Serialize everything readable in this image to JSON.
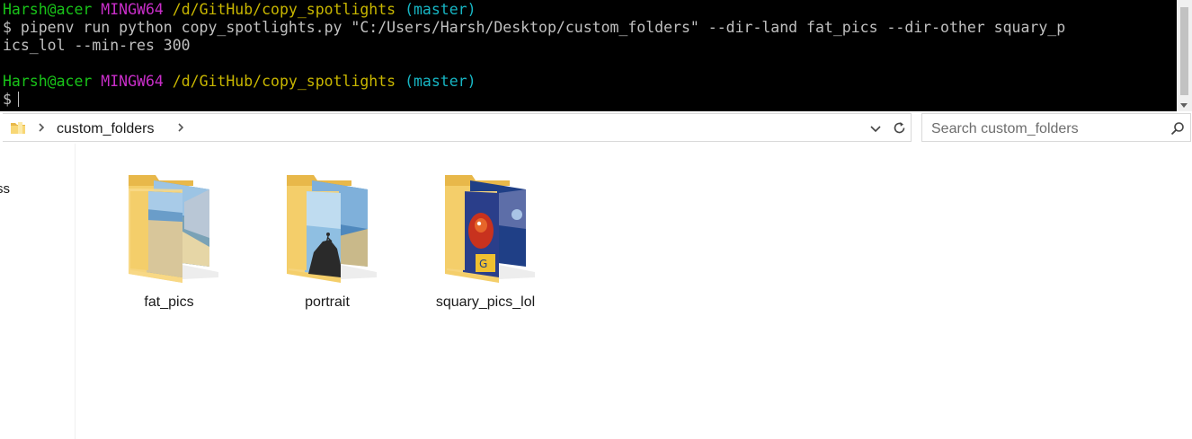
{
  "terminal": {
    "prompt1": {
      "user": "Harsh@acer",
      "system": "MINGW64",
      "path": "/d/GitHub/copy_spotlights",
      "branch": "(master)"
    },
    "command_line_1": "$ pipenv run python copy_spotlights.py \"C:/Users/Harsh/Desktop/custom_folders\" --dir-land fat_pics --dir-other squary_p",
    "command_line_2": "ics_lol --min-res 300",
    "prompt2": {
      "user": "Harsh@acer",
      "system": "MINGW64",
      "path": "/d/GitHub/copy_spotlights",
      "branch": "(master)"
    },
    "input_prompt": "$",
    "colors": {
      "user": "#19c419",
      "system": "#c92ec9",
      "path": "#c8b600",
      "branch": "#17b6c4",
      "text": "#c0c0c0"
    }
  },
  "address_bar": {
    "breadcrumb": [
      "custom_folders"
    ],
    "icons": [
      "folder-icon",
      "chevron-right-icon",
      "chevron-down-icon",
      "refresh-icon"
    ]
  },
  "search": {
    "placeholder": "Search custom_folders",
    "icon": "search-icon"
  },
  "nav_pane": {
    "visible_item_fragment": "ss"
  },
  "folders": [
    {
      "name": "fat_pics",
      "icon": "folder-with-landscape-photos-icon"
    },
    {
      "name": "portrait",
      "icon": "folder-with-climber-photo-icon"
    },
    {
      "name": "squary_pics_lol",
      "icon": "folder-with-square-art-icon"
    }
  ]
}
